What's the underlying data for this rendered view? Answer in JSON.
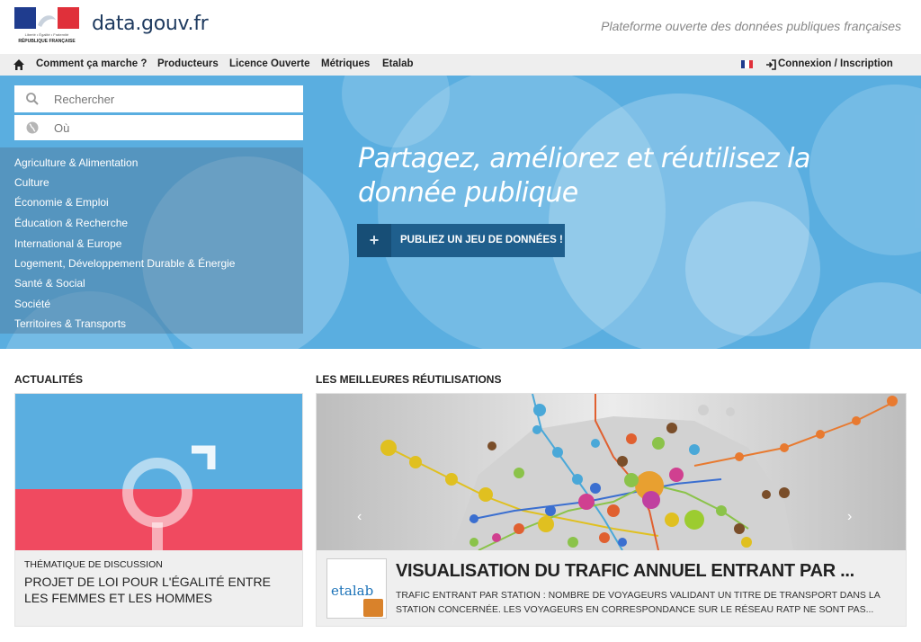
{
  "header": {
    "logo_lines": [
      "Liberté • Égalité • Fraternité",
      "RÉPUBLIQUE FRANÇAISE"
    ],
    "site_name": "data.gouv.fr",
    "tagline": "Plateforme ouverte des données publiques françaises"
  },
  "nav": {
    "items": [
      "Comment ça marche ?",
      "Producteurs",
      "Licence Ouverte",
      "Métriques",
      "Etalab"
    ],
    "login": "Connexion / Inscription",
    "flag_colors": [
      "#1f3c8e",
      "#ffffff",
      "#e0303a"
    ]
  },
  "search": {
    "query_placeholder": "Rechercher",
    "where_placeholder": "Où"
  },
  "topics": [
    "Agriculture & Alimentation",
    "Culture",
    "Économie & Emploi",
    "Éducation & Recherche",
    "International & Europe",
    "Logement, Développement Durable & Énergie",
    "Santé & Social",
    "Société",
    "Territoires & Transports"
  ],
  "hero": {
    "title": "Partagez, améliorez et réutilisez la donnée publique",
    "publish_button": "PUBLIEZ UN JEU DE DONNÉES !",
    "background_color": "#5aaee0"
  },
  "news": {
    "section_title": "ACTUALITÉS",
    "kicker": "THÉMATIQUE DE DISCUSSION",
    "headline": "PROJET DE LOI POUR L'ÉGALITÉ ENTRE LES FEMMES ET LES HOMMES"
  },
  "reuses": {
    "section_title": "LES MEILLEURES RÉUTILISATIONS",
    "thumb_text": "etalab",
    "title": "VISUALISATION DU TRAFIC ANNUEL ENTRANT PAR ...",
    "description": "TRAFIC ENTRANT PAR STATION : NOMBRE DE VOYAGEURS VALIDANT UN TITRE DE TRANSPORT DANS LA STATION CONCERNÉE. LES VOYAGEURS EN CORRESPONDANCE SUR LE RÉSEAU RATP NE SONT PAS...",
    "prev_arrow": "‹",
    "next_arrow": "›"
  }
}
